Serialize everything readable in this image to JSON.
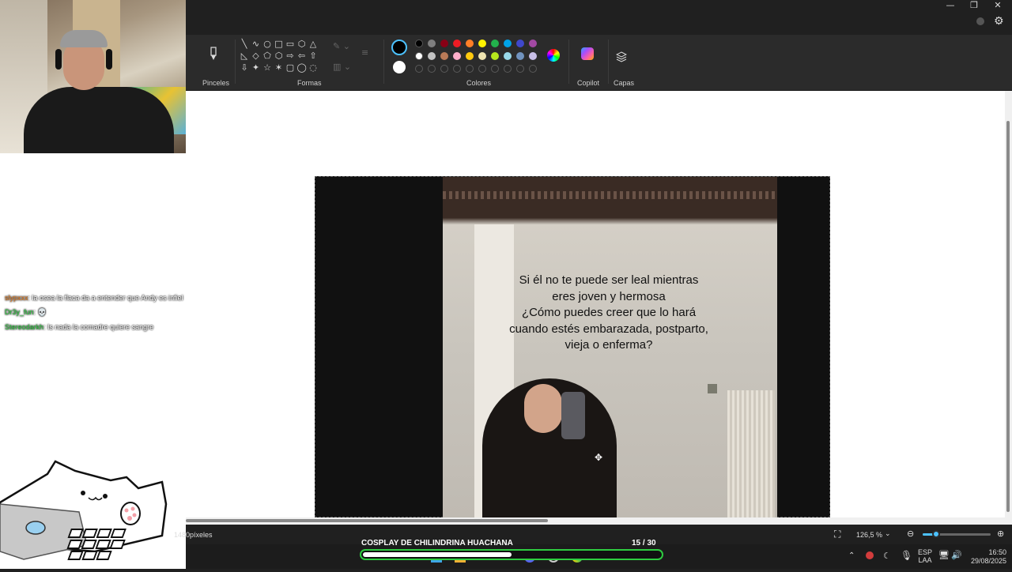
{
  "window": {
    "minimize": "—",
    "restore": "❐",
    "close": "✕"
  },
  "ribbon": {
    "groups": {
      "brushes": "Pinceles",
      "shapes": "Formas",
      "colors": "Colores",
      "copilot": "Copilot",
      "layers": "Capas"
    },
    "shape_glyphs": [
      "╲",
      "∿",
      "○",
      "□",
      "▭",
      "⬡",
      "△",
      "◺",
      "◇",
      "⬠",
      "⬡",
      "⇨",
      "⇦",
      "⇧",
      "⇩",
      "✦",
      "☆",
      "✶",
      "▢",
      "◯",
      "◌"
    ],
    "palette_row1": [
      "#000000",
      "#7f7f7f",
      "#880015",
      "#ed1c24",
      "#ff7f27",
      "#fff200",
      "#22b14c",
      "#00a2e8",
      "#3f48cc",
      "#a349a4"
    ],
    "palette_row2": [
      "#ffffff",
      "#c3c3c3",
      "#b97a57",
      "#ffaec9",
      "#ffc90e",
      "#efe4b0",
      "#b5e61d",
      "#99d9ea",
      "#7092be",
      "#c8bfe7"
    ],
    "primary_color": "#000000",
    "secondary_color": "#ffffff"
  },
  "chat": [
    {
      "user": "slypxxx",
      "user_color": "#e67e22",
      "message": ": la osea la flaca da a entender que Andy es infiel"
    },
    {
      "user": "Dr3y_fun",
      "user_color": "#2ecc40",
      "message": ": 💀"
    },
    {
      "user": "Stereodarkh",
      "user_color": "#2ecc40",
      "message": ": Is nada la comadre quiere sangre"
    }
  ],
  "canvas": {
    "caption_lines": [
      "Si él no te puede ser leal mientras",
      "eres joven y hermosa",
      "¿Cómo puedes creer que lo hará",
      "cuando estés embarazada, postparto,",
      "vieja o enferma?"
    ]
  },
  "status": {
    "size_text": "1480píxeles",
    "zoom": "126,5 %"
  },
  "goal": {
    "title": "COSPLAY DE CHILINDRINA HUACHANA",
    "count": "15  / 30",
    "progress": 0.5
  },
  "tray": {
    "lang1": "ESP",
    "lang2": "LAA",
    "time": "16:50",
    "date": "29/08/2025"
  }
}
